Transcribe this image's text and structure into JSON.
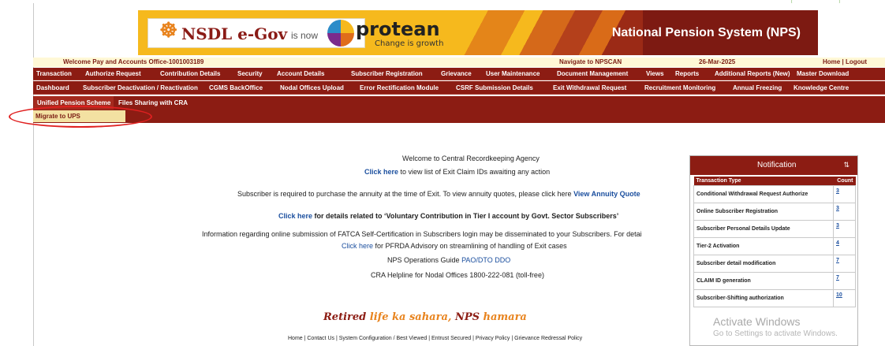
{
  "banner": {
    "nsdl_logo": "NSDL e-Gov",
    "is_now": "is now",
    "protean": "protean",
    "protean_tagline": "Change is growth",
    "title": "National Pension System (NPS)",
    "brand_color": "#8c1c13",
    "accent_color": "#f6b91d"
  },
  "infobar": {
    "welcome": "Welcome Pay and Accounts Office-1001003189",
    "navigate": "Navigate to NPSCAN",
    "date": "26-Mar-2025",
    "home": "Home",
    "separator": "|",
    "logout": "Logout"
  },
  "menu1": [
    "Transaction",
    "Authorize Request",
    "Contribution Details",
    "Security",
    "Account Details",
    "Subscriber Registration",
    "Grievance",
    "User Maintenance",
    "Document Management",
    "Views",
    "Reports",
    "Additional Reports (New)",
    "Master Download"
  ],
  "menu2": [
    "Dashboard",
    "Subscriber Deactivation / Reactivation",
    "CGMS BackOffice",
    "Nodal Offices Upload",
    "Error Rectification Module",
    "CSRF Submission Details",
    "Exit Withdrawal Request",
    "Recruitment Monitoring",
    "Annual Freezing",
    "Knowledge Centre"
  ],
  "menu3": [
    "Unified Pension Scheme",
    "Files Sharing with CRA"
  ],
  "submenu": {
    "migrate": "Migrate to UPS"
  },
  "main": {
    "welcome": "Welcome to Central Recordkeeping Agency",
    "click_here": "Click here",
    "exit_claim_text": " to view list of Exit Claim IDs awaiting any action",
    "annuity_text": "Subscriber is required to purchase the annuity at the time of Exit. To view annuity quotes, please click here ",
    "annuity_link": "View Annuity Quote",
    "voluntary_text": " for details related to ‘Voluntary Contribution in Tier I account by Govt. Sector Subscribers’",
    "fatca_text": "Information regarding online submission of FATCA Self-Certification in Subscribers login may be disseminated to your Subscribers. For detai",
    "pfrda_text": " for PFRDA Advisory on streamlining of handling of Exit cases",
    "ops_guide_text": "NPS Operations Guide ",
    "ops_guide_link": "PAO/DTO DDO",
    "helpline": "CRA Helpline for Nodal Offices 1800-222-081 (toll-free)"
  },
  "tagline": {
    "part1": "Retired ",
    "part2": "life ka sahara, ",
    "part3": "NPS ",
    "part4": "hamara"
  },
  "footer": "Home | Contact Us | System Configuration / Best Viewed | Entrust Secured | Privacy Policy | Grievance Redressal Policy",
  "notification": {
    "title": "Notification",
    "sort_icon": "⇅",
    "col_type": "Transaction Type",
    "col_count": "Count",
    "rows": [
      {
        "type": "Conditional Withdrawal Request Authorize",
        "count": "3"
      },
      {
        "type": "Online Subscriber Registration",
        "count": "3"
      },
      {
        "type": "Subscriber Personal Details Update",
        "count": "3"
      },
      {
        "type": "Tier-2 Activation",
        "count": "4"
      },
      {
        "type": "Subscriber detail modification",
        "count": "7"
      },
      {
        "type": "CLAIM ID generation",
        "count": "7"
      },
      {
        "type": "Subscriber-Shifting authorization",
        "count": "10"
      }
    ]
  },
  "watermark": {
    "line1": "Activate Windows",
    "line2": "Go to Settings to activate Windows."
  }
}
